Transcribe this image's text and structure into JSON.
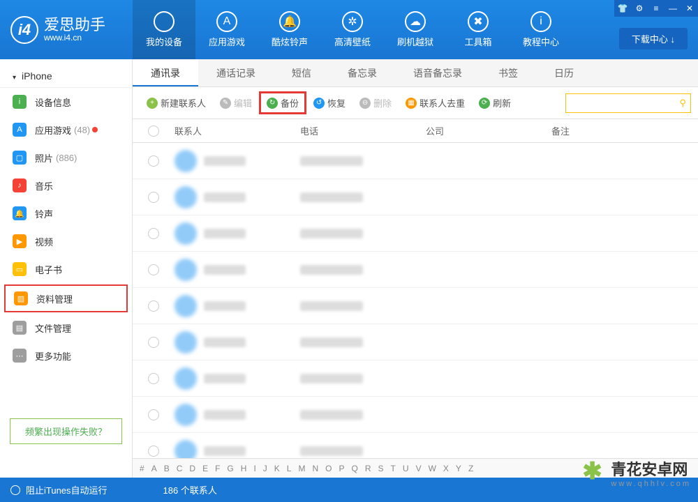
{
  "logo": {
    "main": "爱思助手",
    "sub": "www.i4.cn"
  },
  "nav": [
    "我的设备",
    "应用游戏",
    "酷炫铃声",
    "高清壁纸",
    "刷机越狱",
    "工具箱",
    "教程中心"
  ],
  "download_center": "下载中心 ↓",
  "device": "iPhone",
  "sidebar": [
    {
      "ico": "#4caf50",
      "glyph": "i",
      "label": "设备信息"
    },
    {
      "ico": "#2196f3",
      "glyph": "A",
      "label": "应用游戏",
      "badge": "(48)",
      "dot": true
    },
    {
      "ico": "#2196f3",
      "glyph": "▢",
      "label": "照片",
      "badge": "(886)"
    },
    {
      "ico": "#f44336",
      "glyph": "♪",
      "label": "音乐"
    },
    {
      "ico": "#2196f3",
      "glyph": "🔔",
      "label": "铃声"
    },
    {
      "ico": "#ff9800",
      "glyph": "▶",
      "label": "视频"
    },
    {
      "ico": "#ffc107",
      "glyph": "▭",
      "label": "电子书"
    },
    {
      "ico": "#ff9800",
      "glyph": "▥",
      "label": "资料管理",
      "hl": true
    },
    {
      "ico": "#9e9e9e",
      "glyph": "▤",
      "label": "文件管理"
    },
    {
      "ico": "#9e9e9e",
      "glyph": "⋯",
      "label": "更多功能"
    }
  ],
  "help_link": "频繁出现操作失败？",
  "sub_tabs": [
    "通讯录",
    "通话记录",
    "短信",
    "备忘录",
    "语音备忘录",
    "书签",
    "日历"
  ],
  "toolbar": [
    {
      "ico": "#8bc34a",
      "glyph": "+",
      "label": "新建联系人"
    },
    {
      "ico": "#bbb",
      "glyph": "✎",
      "label": "编辑",
      "disabled": true
    },
    {
      "ico": "#4caf50",
      "glyph": "↻",
      "label": "备份",
      "hl": true
    },
    {
      "ico": "#2196f3",
      "glyph": "↺",
      "label": "恢复"
    },
    {
      "ico": "#bbb",
      "glyph": "⊖",
      "label": "删除",
      "disabled": true
    },
    {
      "ico": "#ff9800",
      "glyph": "▦",
      "label": "联系人去重"
    },
    {
      "ico": "#4caf50",
      "glyph": "⟳",
      "label": "刷新"
    }
  ],
  "columns": {
    "contact": "联系人",
    "phone": "电话",
    "company": "公司",
    "note": "备注"
  },
  "row_count": 9,
  "alpha": [
    "#",
    "A",
    "B",
    "C",
    "D",
    "E",
    "F",
    "G",
    "H",
    "I",
    "J",
    "K",
    "L",
    "M",
    "N",
    "O",
    "P",
    "Q",
    "R",
    "S",
    "T",
    "U",
    "V",
    "W",
    "X",
    "Y",
    "Z"
  ],
  "footer": {
    "itunes": "阻止iTunes自动运行",
    "count": "186 个联系人"
  },
  "watermark": {
    "title": "青花安卓网",
    "sub": "www.qhhlv.com"
  }
}
